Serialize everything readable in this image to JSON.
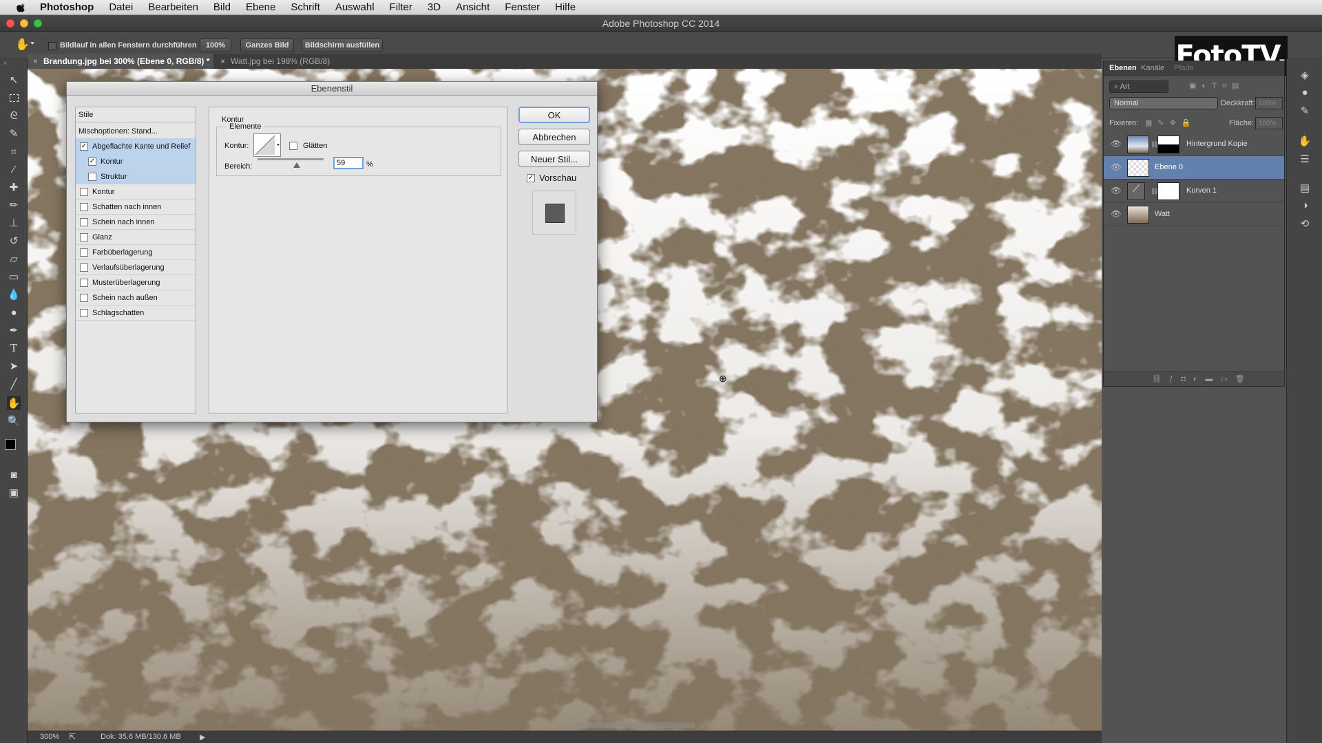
{
  "menubar": {
    "app_name": "Photoshop",
    "items": [
      "Datei",
      "Bearbeiten",
      "Bild",
      "Ebene",
      "Schrift",
      "Auswahl",
      "Filter",
      "3D",
      "Ansicht",
      "Fenster",
      "Hilfe"
    ]
  },
  "window": {
    "title": "Adobe Photoshop CC 2014"
  },
  "options_bar": {
    "scroll_all_label": "Bildlauf in allen Fenstern durchführen",
    "zoom_100_label": "100%",
    "fit_label": "Ganzes Bild",
    "fill_screen_label": "Bildschirm ausfüllen"
  },
  "tabs": [
    {
      "label": "Brandung.jpg bei 300% (Ebene 0, RGB/8) *",
      "active": true
    },
    {
      "label": "Watt.jpg bei 198% (RGB/8)",
      "active": false
    }
  ],
  "status": {
    "zoom": "300%",
    "doc": "Dok: 35.6 MB/130.6 MB"
  },
  "watermark": "FotoTV.",
  "layers_panel": {
    "tabs": [
      "Ebenen",
      "Kanäle",
      "Pfade"
    ],
    "filter_placeholder": "Art",
    "blend_mode": "Normal",
    "opacity_label": "Deckkraft:",
    "opacity_value": "100%",
    "lock_label": "Fixieren:",
    "fill_label": "Fläche:",
    "fill_value": "100%",
    "layers": [
      {
        "name": "Hintergrund Kopie",
        "selected": false
      },
      {
        "name": "Ebene 0",
        "selected": true
      },
      {
        "name": "Kurven 1",
        "selected": false
      },
      {
        "name": "Watt",
        "selected": false
      }
    ]
  },
  "dialog": {
    "title": "Ebenenstil",
    "styles_header": "Stile",
    "blend_options": "Mischoptionen: Stand...",
    "styles": [
      {
        "label": "Abgeflachte Kante und Relief",
        "checked": true,
        "selected": true,
        "indent": false
      },
      {
        "label": "Kontur",
        "checked": true,
        "selected": true,
        "indent": true
      },
      {
        "label": "Struktur",
        "checked": false,
        "selected": true,
        "indent": true
      },
      {
        "label": "Kontur",
        "checked": false,
        "selected": false,
        "indent": false
      },
      {
        "label": "Schatten nach innen",
        "checked": false,
        "selected": false,
        "indent": false
      },
      {
        "label": "Schein nach innen",
        "checked": false,
        "selected": false,
        "indent": false
      },
      {
        "label": "Glanz",
        "checked": false,
        "selected": false,
        "indent": false
      },
      {
        "label": "Farbüberlagerung",
        "checked": false,
        "selected": false,
        "indent": false
      },
      {
        "label": "Verlaufsüberlagerung",
        "checked": false,
        "selected": false,
        "indent": false
      },
      {
        "label": "Musterüberlagerung",
        "checked": false,
        "selected": false,
        "indent": false
      },
      {
        "label": "Schein nach außen",
        "checked": false,
        "selected": false,
        "indent": false
      },
      {
        "label": "Schlagschatten",
        "checked": false,
        "selected": false,
        "indent": false
      }
    ],
    "section_title": "Kontur",
    "group_title": "Elemente",
    "contour_label": "Kontur:",
    "smooth_label": "Glätten",
    "range_label": "Bereich:",
    "range_value": "59",
    "range_unit": "%",
    "range_fraction": 0.59,
    "ok_label": "OK",
    "cancel_label": "Abbrechen",
    "new_style_label": "Neuer Stil...",
    "preview_label": "Vorschau"
  }
}
